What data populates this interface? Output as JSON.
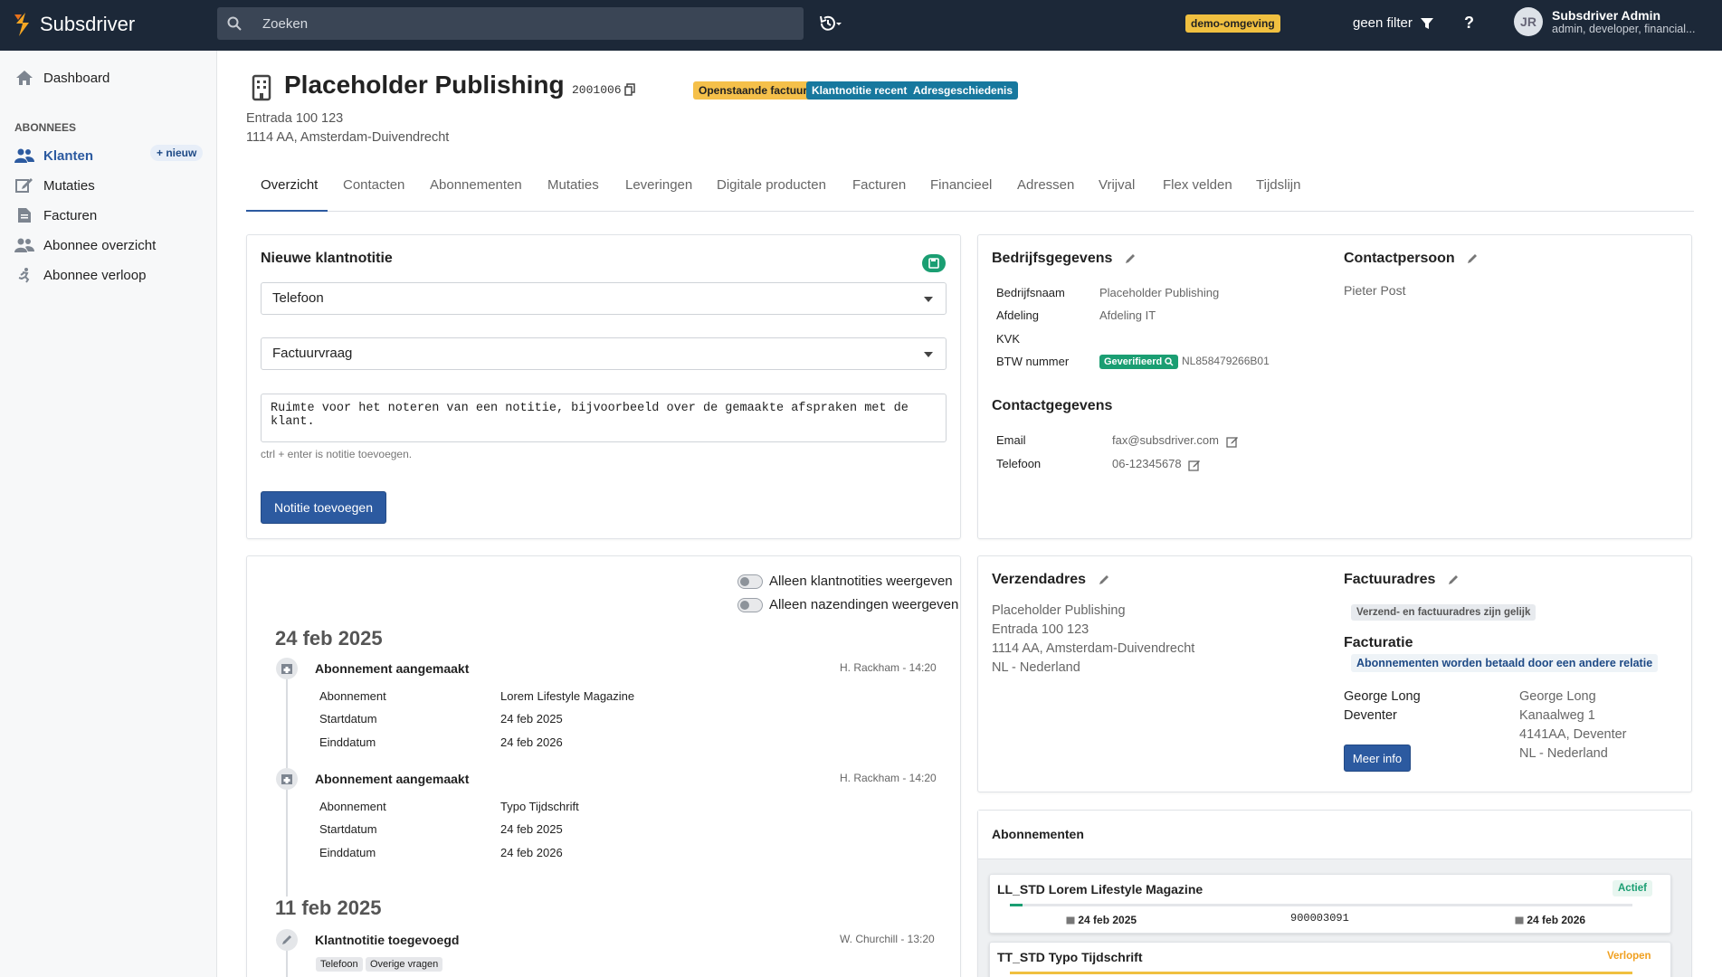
{
  "app": {
    "brand": "Subsdriver"
  },
  "topbar": {
    "search_placeholder": "Zoeken",
    "demo_badge": "demo-omgeving",
    "filter_label": "geen filter",
    "help": "?",
    "user_initials": "JR",
    "user_name": "Subsdriver Admin",
    "user_roles": "admin, developer, financial..."
  },
  "sidebar": {
    "dashboard": "Dashboard",
    "section": "ABONNEES",
    "new_label": "+ nieuw",
    "items": [
      "Klanten",
      "Mutaties",
      "Facturen",
      "Abonnee overzicht",
      "Abonnee verloop"
    ]
  },
  "customer": {
    "name": "Placeholder Publishing",
    "id": "2001006",
    "badges": [
      {
        "label": "Openstaande factuur",
        "bg": "#f5c04a",
        "fg": "#222"
      },
      {
        "label": "Klantnotitie recent",
        "bg": "#17789e",
        "fg": "#ffffff"
      },
      {
        "label": "Adresgeschiedenis",
        "bg": "#17789e",
        "fg": "#ffffff"
      }
    ],
    "address_line1": "Entrada 100 123",
    "address_line2": "1114 AA, Amsterdam-Duivendrecht"
  },
  "tabs": [
    "Overzicht",
    "Contacten",
    "Abonnementen",
    "Mutaties",
    "Leveringen",
    "Digitale producten",
    "Facturen",
    "Financieel",
    "Adressen",
    "Vrijval",
    "Flex velden",
    "Tijdslijn"
  ],
  "note": {
    "title": "Nieuwe klantnotitie",
    "channel": "Telefoon",
    "category": "Factuurvraag",
    "placeholder": "Ruimte voor het noteren van een notitie, bijvoorbeeld over de gemaakte afspraken met de klant.",
    "hint": "ctrl + enter is notitie toevoegen.",
    "button": "Notitie toevoegen"
  },
  "company": {
    "title": "Bedrijfsgegevens",
    "labels": [
      "Bedrijfsnaam",
      "Afdeling",
      "KVK",
      "BTW nummer"
    ],
    "values": [
      "Placeholder Publishing",
      "Afdeling IT",
      ""
    ],
    "verified": "Geverifieerd",
    "vat": "NL858479266B01",
    "contact_title": "Contactpersoon",
    "contact_name": "Pieter Post",
    "contactdata_title": "Contactgegevens",
    "email_label": "Email",
    "email": "fax@subsdriver.com",
    "phone_label": "Telefoon",
    "phone": "06-12345678"
  },
  "timeline": {
    "toggle1": "Alleen klantnotities weergeven",
    "toggle2": "Alleen nazendingen weergeven",
    "date1": "24 feb 2025",
    "date2": "11 feb 2025",
    "events": [
      {
        "title": "Abonnement aangemaakt",
        "meta": "H. Rackham - 14:20",
        "rows": [
          [
            "Abonnement",
            "Lorem Lifestyle Magazine"
          ],
          [
            "Startdatum",
            "24 feb 2025"
          ],
          [
            "Einddatum",
            "24 feb 2026"
          ]
        ]
      },
      {
        "title": "Abonnement aangemaakt",
        "meta": "H. Rackham - 14:20",
        "rows": [
          [
            "Abonnement",
            "Typo Tijdschrift"
          ],
          [
            "Startdatum",
            "24 feb 2025"
          ],
          [
            "Einddatum",
            "24 feb 2026"
          ]
        ]
      },
      {
        "title": "Klantnotitie toegevoegd",
        "meta": "W. Churchill - 13:20",
        "tags": [
          "Telefoon",
          "Overige vragen"
        ]
      }
    ]
  },
  "shipping": {
    "title": "Verzendadres",
    "lines": [
      "Placeholder Publishing",
      "Entrada 100 123",
      "1114 AA, Amsterdam-Duivendrecht",
      "NL - Nederland"
    ],
    "invoice_title": "Factuuradres",
    "same_badge": "Verzend- en factuuradres zijn gelijk",
    "billing_title": "Facturatie",
    "billing_note": "Abonnementen worden betaald door een andere relatie",
    "payer_left": [
      "George Long",
      "Deventer"
    ],
    "payer_right": [
      "George Long",
      "Kanaalweg 1",
      "4141AA, Deventer",
      "NL - Nederland"
    ],
    "more_button": "Meer info"
  },
  "subscriptions": {
    "title": "Abonnementen",
    "items": [
      {
        "name": "LL_STD Lorem Lifestyle Magazine",
        "status": "Actief",
        "status_color": "#1a9e72",
        "start": "24 feb 2025",
        "number": "900003091",
        "end": "24 feb 2026",
        "progress": 0.02
      },
      {
        "name": "TT_STD Typo Tijdschrift",
        "status": "Verlopen",
        "status_color": "#f0a020",
        "progress": 1.0
      }
    ]
  }
}
